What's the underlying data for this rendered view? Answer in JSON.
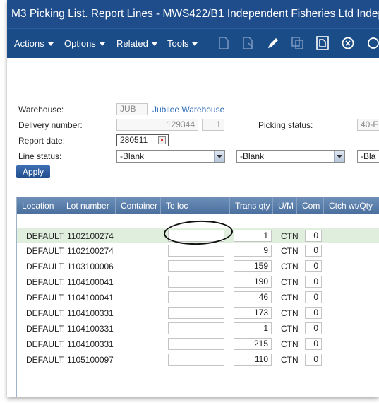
{
  "window": {
    "title": "M3 Picking List. Report Lines - MWS422/B1   Independent Fisheries Ltd Independen"
  },
  "menubar": {
    "menus": [
      "Actions",
      "Options",
      "Related",
      "Tools"
    ],
    "toolbar_icons": [
      "new-icon",
      "copy-icon",
      "edit-icon",
      "duplicate-icon",
      "display-icon",
      "delete-icon",
      "refresh-icon"
    ]
  },
  "form": {
    "warehouse_label": "Warehouse:",
    "warehouse_code": "JUB",
    "warehouse_name": "Jubilee Warehouse",
    "delivery_label": "Delivery number:",
    "delivery_number": "129344",
    "delivery_suffix": "1",
    "picking_status_label": "Picking status:",
    "picking_status_value": "40-F",
    "report_date_label": "Report date:",
    "report_date_value": "280511",
    "line_status_label": "Line status:",
    "line_status_1": "-Blank",
    "line_status_2": "-Blank",
    "line_status_3": "-Bla",
    "apply_label": "Apply"
  },
  "grid": {
    "columns": [
      "Location",
      "Lot number",
      "Container",
      "To loc",
      "Trans qty",
      "U/M",
      "Com",
      "Ctch wt/Qty"
    ],
    "rows": [
      {
        "location": "DEFAULT",
        "lot": "1102100274",
        "to_loc": "",
        "qty": "1",
        "um": "CTN",
        "com": "0"
      },
      {
        "location": "DEFAULT",
        "lot": "1102100274",
        "to_loc": "",
        "qty": "9",
        "um": "CTN",
        "com": "0"
      },
      {
        "location": "DEFAULT",
        "lot": "1103100006",
        "to_loc": "",
        "qty": "159",
        "um": "CTN",
        "com": "0"
      },
      {
        "location": "DEFAULT",
        "lot": "1104100041",
        "to_loc": "",
        "qty": "190",
        "um": "CTN",
        "com": "0"
      },
      {
        "location": "DEFAULT",
        "lot": "1104100041",
        "to_loc": "",
        "qty": "46",
        "um": "CTN",
        "com": "0"
      },
      {
        "location": "DEFAULT",
        "lot": "1104100331",
        "to_loc": "",
        "qty": "173",
        "um": "CTN",
        "com": "0"
      },
      {
        "location": "DEFAULT",
        "lot": "1104100331",
        "to_loc": "",
        "qty": "1",
        "um": "CTN",
        "com": "0"
      },
      {
        "location": "DEFAULT",
        "lot": "1104100331",
        "to_loc": "",
        "qty": "215",
        "um": "CTN",
        "com": "0"
      },
      {
        "location": "DEFAULT",
        "lot": "1105100097",
        "to_loc": "",
        "qty": "110",
        "um": "CTN",
        "com": "0"
      }
    ]
  },
  "colors": {
    "titlebar": "#1f4d8c",
    "selected_row": "#dfeedd",
    "link": "#2a6ab8"
  }
}
